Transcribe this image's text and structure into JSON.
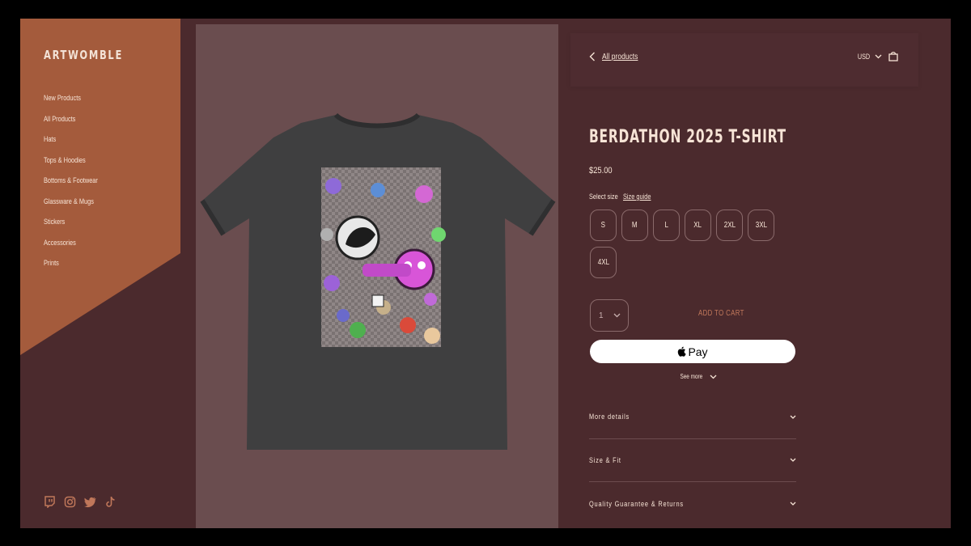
{
  "brand": {
    "logo": "ARTWOMBLE",
    "panel_color": "#a45b3c"
  },
  "sidebar": {
    "items": [
      {
        "label": "New Products"
      },
      {
        "label": "All Products"
      },
      {
        "label": "Hats"
      },
      {
        "label": "Tops & Hoodies"
      },
      {
        "label": "Bottoms & Footwear"
      },
      {
        "label": "Glassware & Mugs"
      },
      {
        "label": "Stickers"
      },
      {
        "label": "Accessories"
      },
      {
        "label": "Prints"
      }
    ],
    "social": [
      "twitch-icon",
      "instagram-icon",
      "twitter-icon",
      "tiktok-icon"
    ]
  },
  "topbar": {
    "back_label": "All products",
    "currency": "USD"
  },
  "product": {
    "title": "BERDATHON 2025 T-SHIRT",
    "price": "$25.00",
    "select_size_label": "Select size",
    "size_guide_label": "Size guide",
    "sizes": [
      "S",
      "M",
      "L",
      "XL",
      "2XL",
      "3XL",
      "4XL"
    ],
    "quantity": "1",
    "add_to_cart_label": "ADD TO CART",
    "apple_pay_label": "Pay",
    "see_more_label": "See more"
  },
  "accordions": [
    {
      "label": "More details"
    },
    {
      "label": "Size & Fit"
    },
    {
      "label": "Quality Guarantee & Returns"
    }
  ],
  "colors": {
    "background": "#4b2a2d",
    "image_panel": "#6a4d4f",
    "text": "#f7e4d6",
    "accent": "#c0775a"
  }
}
